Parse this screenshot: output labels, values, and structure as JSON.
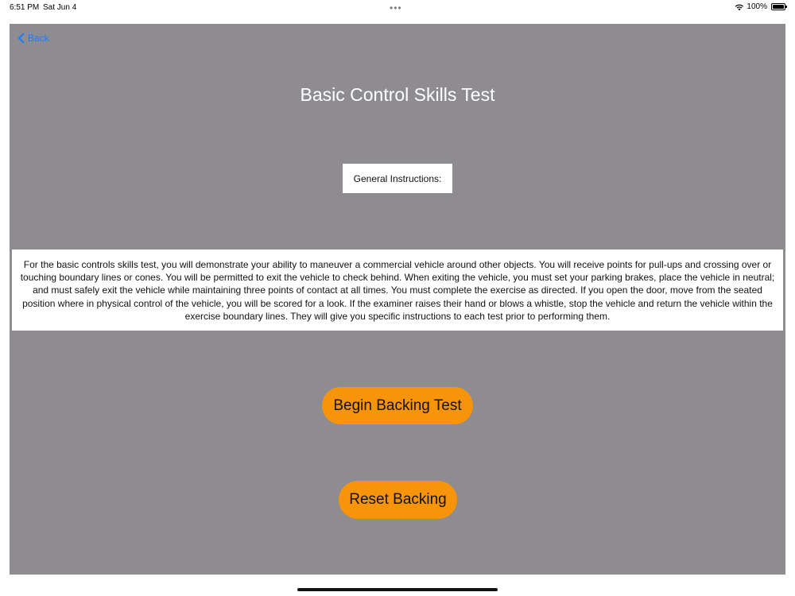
{
  "status_bar": {
    "time": "6:51 PM",
    "date": "Sat Jun 4",
    "dots": "•••",
    "battery_percent": "100%"
  },
  "nav": {
    "back_label": "Back"
  },
  "page": {
    "title": "Basic Control Skills Test",
    "instructions_label": "General Instructions:",
    "instructions_text": "For the basic controls skills test, you will demonstrate your ability to maneuver a commercial vehicle around other objects. You will receive points for pull-ups and crossing over or touching boundary lines or cones. You will be permitted to exit the vehicle to check behind. When exiting the vehicle, you must set your parking brakes, place the vehicle in neutral; and must safely exit the vehicle while maintaining three points of contact at all times. You must complete the exercise as directed. If you open the door, move from the seated position where in physical control of the vehicle, you will be scored for a look. If the examiner raises their hand or blows a whistle, stop the vehicle and return the vehicle within the exercise boundary lines. They will give you specific instructions to each test prior to performing them."
  },
  "actions": {
    "begin_label": "Begin Backing Test",
    "reset_label": "Reset Backing"
  },
  "colors": {
    "panel_background": "#8e8c91",
    "button_orange": "#f7940b",
    "link_blue": "#1a7cf5"
  }
}
